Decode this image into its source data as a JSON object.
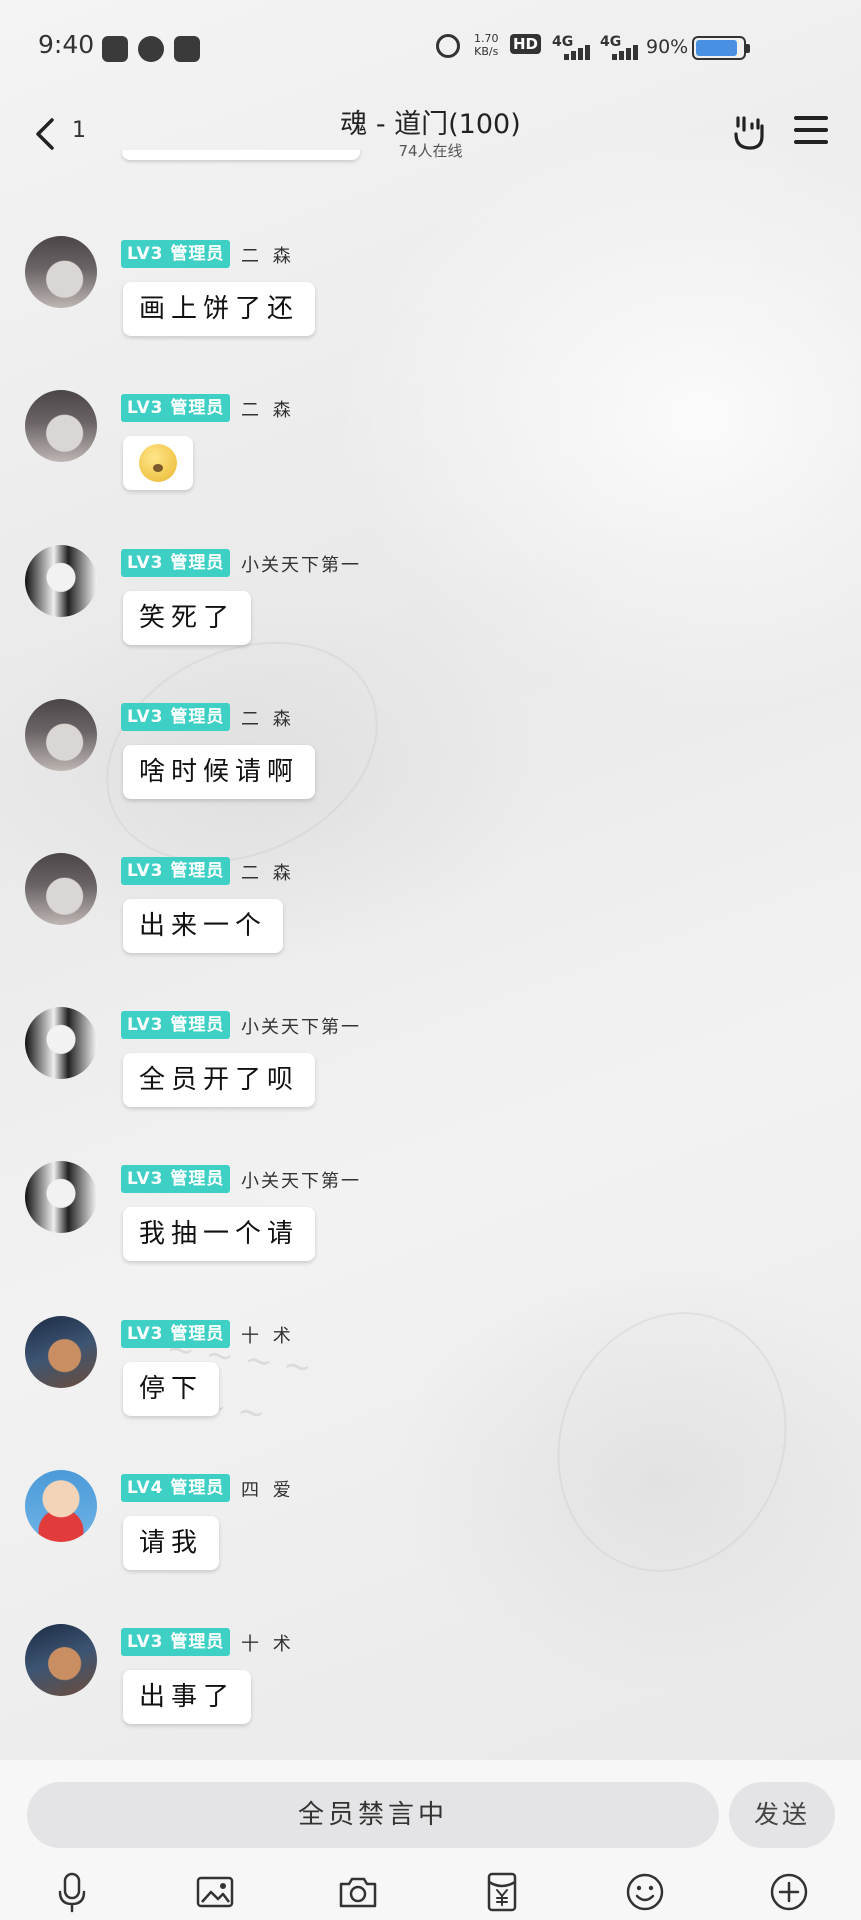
{
  "status_bar": {
    "time": "9:40",
    "net_speed_value": "1.70",
    "net_speed_unit": "KB/s",
    "hd_label": "HD",
    "sim1_label": "4G",
    "sim2_label": "4G",
    "battery_percent": "90%",
    "battery_level": 0.9
  },
  "header": {
    "back_label": "1",
    "title": "魂 - 道门(100)",
    "online_count": "74人在线"
  },
  "messages": [
    {
      "badge": "LV3 管理员",
      "nick": "二  森",
      "text": "画上饼了还",
      "avatar": "sen"
    },
    {
      "badge": "LV3 管理员",
      "nick": "二  森",
      "text": "",
      "sticker": "emoji-sticker",
      "avatar": "sen"
    },
    {
      "badge": "LV3 管理员",
      "nick": "小关天下第一",
      "text": "笑死了",
      "avatar": "xiao"
    },
    {
      "badge": "LV3 管理员",
      "nick": "二  森",
      "text": "啥时候请啊",
      "avatar": "sen"
    },
    {
      "badge": "LV3 管理员",
      "nick": "二  森",
      "text": "出来一个",
      "avatar": "sen"
    },
    {
      "badge": "LV3 管理员",
      "nick": "小关天下第一",
      "text": "全员开了呗",
      "avatar": "xiao"
    },
    {
      "badge": "LV3 管理员",
      "nick": "小关天下第一",
      "text": "我抽一个请",
      "avatar": "xiao"
    },
    {
      "badge": "LV3 管理员",
      "nick": "十  术",
      "text": "停下",
      "avatar": "shi"
    },
    {
      "badge": "LV4 管理员",
      "nick": "四  爱",
      "text": "请我",
      "avatar": "si"
    },
    {
      "badge": "LV3 管理员",
      "nick": "十  术",
      "text": "出事了",
      "avatar": "shi"
    }
  ],
  "input": {
    "mute_text": "全员禁言中",
    "send_label": "发送"
  },
  "toolbar": {
    "icons": [
      "microphone-icon",
      "image-icon",
      "camera-icon",
      "red-packet-icon",
      "emoji-icon",
      "plus-icon"
    ]
  },
  "colors": {
    "badge": "#3ecfc5",
    "battery": "#4a90e2"
  }
}
